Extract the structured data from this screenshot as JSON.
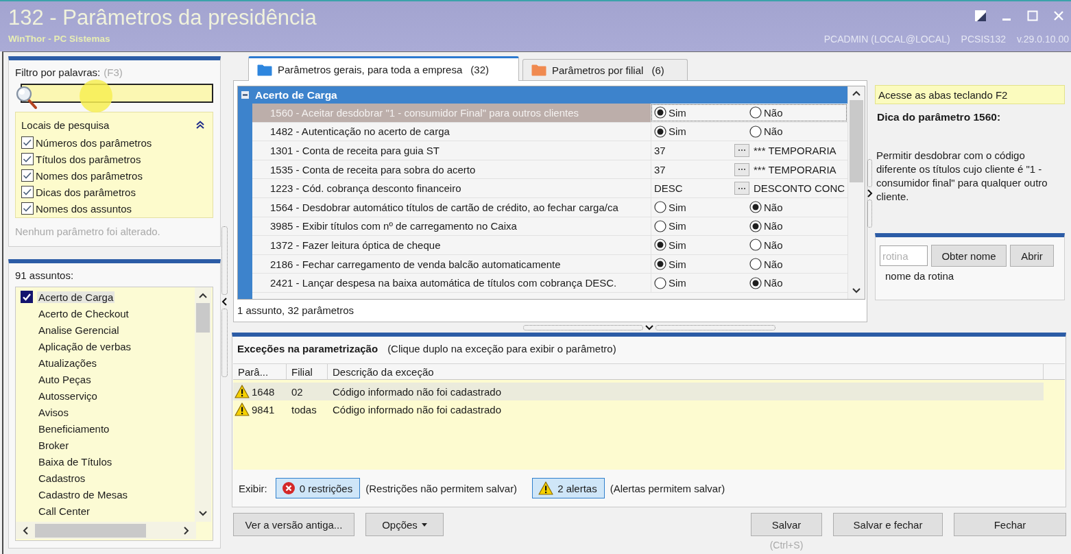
{
  "window": {
    "title": "132 - Parâmetros da presidência",
    "subtitle": "WinThor - PC Sistemas",
    "user": "PCADMIN (LOCAL@LOCAL)",
    "program": "PCSIS132",
    "version": "v.29.0.10.00"
  },
  "filter": {
    "label": "Filtro por palavras:",
    "shortcut": "(F3)"
  },
  "search_locations": {
    "title": "Locais de pesquisa",
    "expanded": true,
    "options": [
      {
        "label": "Números dos parâmetros",
        "checked": true
      },
      {
        "label": "Títulos dos parâmetros",
        "checked": true
      },
      {
        "label": "Nomes dos parâmetros",
        "checked": true
      },
      {
        "label": "Dicas dos parâmetros",
        "checked": true
      },
      {
        "label": "Nomes dos assuntos",
        "checked": true
      }
    ]
  },
  "changes_status": "Nenhum parâmetro foi alterado.",
  "subjects": {
    "count_label": "91 assuntos:",
    "items": [
      {
        "label": "Acerto de Carga",
        "checked": true,
        "selected": true
      },
      {
        "label": "Acerto de Checkout",
        "checked": false,
        "selected": false
      },
      {
        "label": "Analise Gerencial",
        "checked": false,
        "selected": false
      },
      {
        "label": "Aplicação de verbas",
        "checked": false,
        "selected": false
      },
      {
        "label": "Atualizações",
        "checked": false,
        "selected": false
      },
      {
        "label": "Auto Peças",
        "checked": false,
        "selected": false
      },
      {
        "label": "Autosserviço",
        "checked": false,
        "selected": false
      },
      {
        "label": "Avisos",
        "checked": false,
        "selected": false
      },
      {
        "label": "Beneficiamento",
        "checked": false,
        "selected": false
      },
      {
        "label": "Broker",
        "checked": false,
        "selected": false
      },
      {
        "label": "Baixa de Títulos",
        "checked": false,
        "selected": false
      },
      {
        "label": "Cadastros",
        "checked": false,
        "selected": false
      },
      {
        "label": "Cadastro de Mesas",
        "checked": false,
        "selected": false
      },
      {
        "label": "Call Center",
        "checked": false,
        "selected": false
      }
    ]
  },
  "tabs": [
    {
      "label": "Parâmetros gerais, para toda a empresa",
      "count": "(32)",
      "selected": true,
      "color": "#2e86de"
    },
    {
      "label": "Parâmetros por filial",
      "count": "(6)",
      "selected": false,
      "color": "#f08a50"
    }
  ],
  "parameters": {
    "group": {
      "title": "Acerto de Carga",
      "expanded": true
    },
    "rows": [
      {
        "kind": "radio",
        "label": "1560 - Aceitar desdobrar \"1 - consumidor Final\" para outros clientes",
        "selected": true,
        "options": [
          {
            "label": "Sim",
            "selected": true
          },
          {
            "label": "Não",
            "selected": false
          }
        ]
      },
      {
        "kind": "radio",
        "label": "1482 - Autenticação no acerto de carga",
        "selected": false,
        "options": [
          {
            "label": "Sim",
            "selected": true
          },
          {
            "label": "Não",
            "selected": false
          }
        ]
      },
      {
        "kind": "lookup",
        "label": "1301 - Conta de receita para guia ST",
        "selected": false,
        "value": "37",
        "description": "*** TEMPORARIA"
      },
      {
        "kind": "lookup",
        "label": "1535 - Conta de receita para sobra do acerto",
        "selected": false,
        "value": "37",
        "description": "*** TEMPORARIA"
      },
      {
        "kind": "lookup",
        "label": "1223 - Cód. cobrança desconto financeiro",
        "selected": false,
        "value": "DESC",
        "description": "DESCONTO CONC"
      },
      {
        "kind": "radio",
        "label": "1564 - Desdobrar automático títulos de cartão de crédito, ao fechar carga/ca",
        "selected": false,
        "options": [
          {
            "label": "Sim",
            "selected": false
          },
          {
            "label": "Não",
            "selected": true
          }
        ]
      },
      {
        "kind": "radio",
        "label": "3985 - Exibir títulos com nº de carregamento no Caixa",
        "selected": false,
        "options": [
          {
            "label": "Sim",
            "selected": false
          },
          {
            "label": "Não",
            "selected": true
          }
        ]
      },
      {
        "kind": "radio",
        "label": "1372 - Fazer leitura óptica de cheque",
        "selected": false,
        "options": [
          {
            "label": "Sim",
            "selected": true
          },
          {
            "label": "Não",
            "selected": false
          }
        ]
      },
      {
        "kind": "radio",
        "label": "2186 - Fechar carregamento de venda balcão automaticamente",
        "selected": false,
        "options": [
          {
            "label": "Sim",
            "selected": true
          },
          {
            "label": "Não",
            "selected": false
          }
        ]
      },
      {
        "kind": "radio",
        "label": "2421 - Lançar despesa na baixa automática de títulos com cobrança DESC.",
        "selected": false,
        "options": [
          {
            "label": "Sim",
            "selected": false
          },
          {
            "label": "Não",
            "selected": true
          }
        ]
      }
    ],
    "summary": "1 assunto, 32 parâmetros"
  },
  "hint": {
    "banner": "Acesse as abas teclando F2",
    "title": "Dica do parâmetro 1560:",
    "text": "Permitir desdobrar com o código diferente os títulos cujo cliente é \"1 - consumidor final\" para qualquer outro cliente."
  },
  "routine": {
    "placeholder": "rotina",
    "buttons": [
      "Obter nome",
      "Abrir"
    ],
    "name_label": "nome da rotina"
  },
  "exceptions": {
    "title": "Exceções na parametrização",
    "hint": "(Clique duplo na exceção para exibir o parâmetro)",
    "columns": [
      "Parâ...",
      "Filial",
      "Descrição da exceção"
    ],
    "rows": [
      {
        "kind": "alert",
        "param": "1648",
        "branch": "02",
        "description": "Código informado não foi cadastrado",
        "selected": true
      },
      {
        "kind": "alert",
        "param": "9841",
        "branch": "todas",
        "description": "Código informado não foi cadastrado",
        "selected": false
      }
    ],
    "filter_label": "Exibir:",
    "filters": [
      {
        "kind": "restriction",
        "label": "0 restrições",
        "note": "(Restrições não permitem salvar)",
        "on": true
      },
      {
        "kind": "alert",
        "label": "2 alertas",
        "note": "(Alertas permitem salvar)",
        "on": true
      }
    ]
  },
  "footer": {
    "left_buttons": [
      {
        "label": "Ver a versão antiga...",
        "dropdown": false
      },
      {
        "label": "Opções",
        "dropdown": true
      }
    ],
    "right_buttons": [
      {
        "label": "Salvar",
        "shortcut": "(Ctrl+S)"
      },
      {
        "label": "Salvar e fechar"
      },
      {
        "label": "Fechar"
      }
    ]
  }
}
